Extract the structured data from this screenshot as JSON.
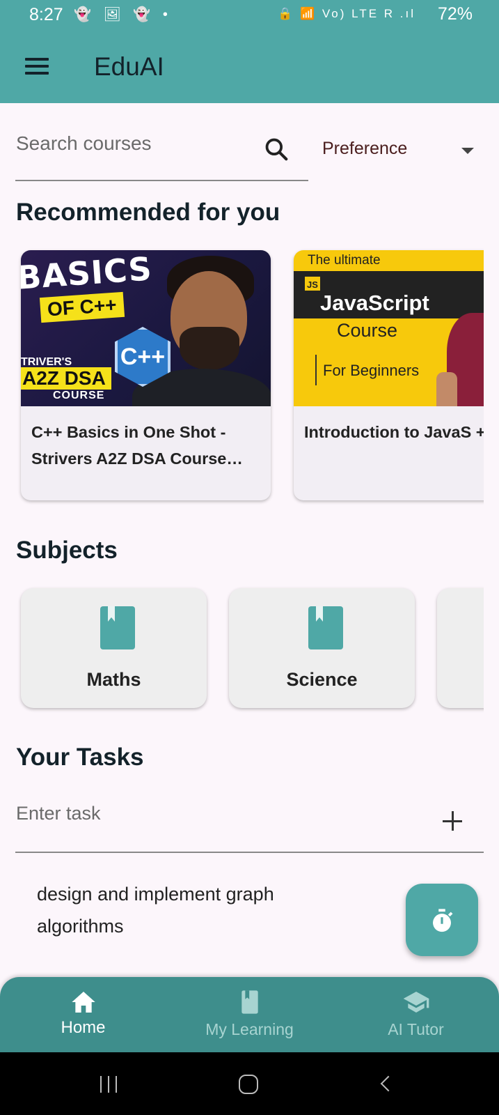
{
  "status_bar": {
    "time": "8:27",
    "notifications": "👻 🖼 👻 •",
    "system_icons": "🔒 📶 Vo) LTE R .ıl",
    "battery": "72%"
  },
  "app_bar": {
    "title": "EduAI",
    "menu_icon": "hamburger-menu-icon"
  },
  "search": {
    "placeholder": "Search courses",
    "icon": "search-icon"
  },
  "preference_dropdown": {
    "selected": "Preference"
  },
  "recommended": {
    "heading": "Recommended for you",
    "courses": [
      {
        "title": "C++ Basics in One Shot - Strivers A2Z DSA Course…",
        "thumbnail": {
          "line1": "BASICS",
          "line2": "OF C++",
          "line3": "TRIVER'S",
          "line4": "A2Z DSA",
          "line5": "COURSE",
          "logo": "C++"
        }
      },
      {
        "title": "Introduction to JavaS + Setup | JavaScript T",
        "thumbnail": {
          "line1": "The ultimate",
          "badge": "JS",
          "line2": "JavaScript",
          "line3": "Course",
          "line4": "For Beginners"
        }
      }
    ]
  },
  "subjects": {
    "heading": "Subjects",
    "items": [
      {
        "label": "Maths",
        "icon": "book-icon"
      },
      {
        "label": "Science",
        "icon": "book-icon"
      },
      {
        "label": "",
        "icon": ""
      }
    ]
  },
  "tasks": {
    "heading": "Your Tasks",
    "input_placeholder": "Enter task",
    "add_icon": "plus-icon",
    "items": [
      "design and implement graph algorithms"
    ]
  },
  "fab": {
    "icon": "timer-icon"
  },
  "bottom_nav": {
    "items": [
      {
        "label": "Home",
        "icon": "home-icon",
        "active": true
      },
      {
        "label": "My Learning",
        "icon": "book-icon",
        "active": false
      },
      {
        "label": "AI Tutor",
        "icon": "graduation-cap-icon",
        "active": false
      }
    ]
  },
  "colors": {
    "primary": "#4fa8a6",
    "nav_bg": "#3e8e8c",
    "background": "#fcf6fb",
    "heading": "#13222a"
  }
}
